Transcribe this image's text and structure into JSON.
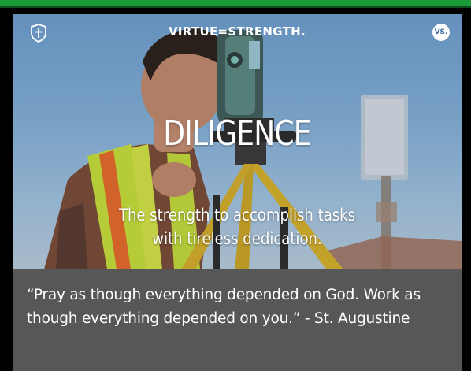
{
  "header": {
    "brand_title": "VIRTUE=STRENGTH.",
    "badge_label": "VS."
  },
  "hero": {
    "title": "DILIGENCE",
    "subtitle_line1": "The strength to accomplish tasks",
    "subtitle_line2": "with tireless dedication."
  },
  "quote": {
    "text": "“Pray as though everything depended on God. Work as though everything depended on you.” - St. Augustine"
  },
  "colors": {
    "top_bar": "#1c9a3a",
    "card_background": "#575757",
    "text": "#ffffff"
  },
  "icons": {
    "brand": "shield-cross-icon",
    "badge": "vs-badge-icon"
  }
}
